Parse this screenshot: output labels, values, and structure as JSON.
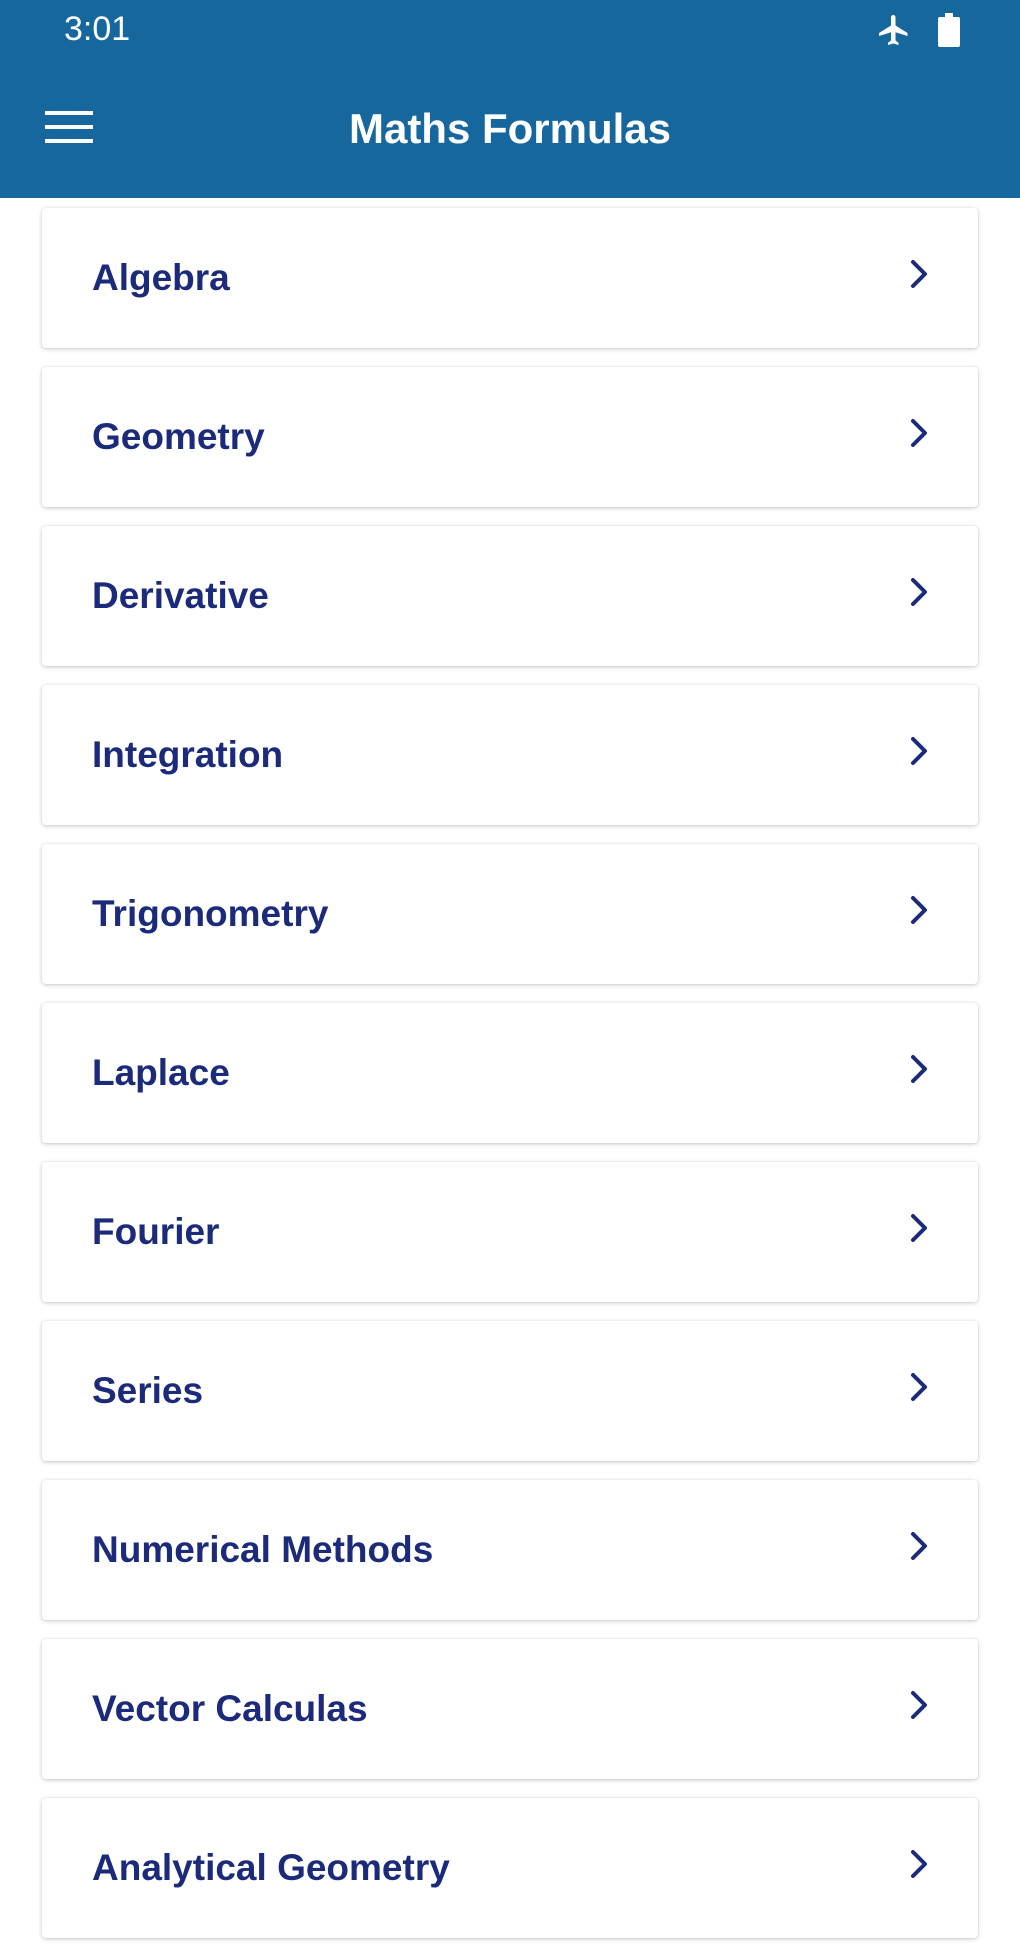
{
  "status_bar": {
    "time": "3:01",
    "icons": [
      "airplane-mode-icon",
      "battery-icon"
    ]
  },
  "app_bar": {
    "title": "Maths Formulas",
    "menu_icon": "hamburger-menu-icon",
    "background_color": "#15679e"
  },
  "categories": [
    {
      "label": "Algebra"
    },
    {
      "label": "Geometry"
    },
    {
      "label": "Derivative"
    },
    {
      "label": "Integration"
    },
    {
      "label": "Trigonometry"
    },
    {
      "label": "Laplace"
    },
    {
      "label": "Fourier"
    },
    {
      "label": "Series"
    },
    {
      "label": "Numerical Methods"
    },
    {
      "label": "Vector Calculas"
    },
    {
      "label": "Analytical Geometry"
    }
  ],
  "colors": {
    "label_text": "#1b2a7a",
    "chevron": "#1b2a7a"
  }
}
